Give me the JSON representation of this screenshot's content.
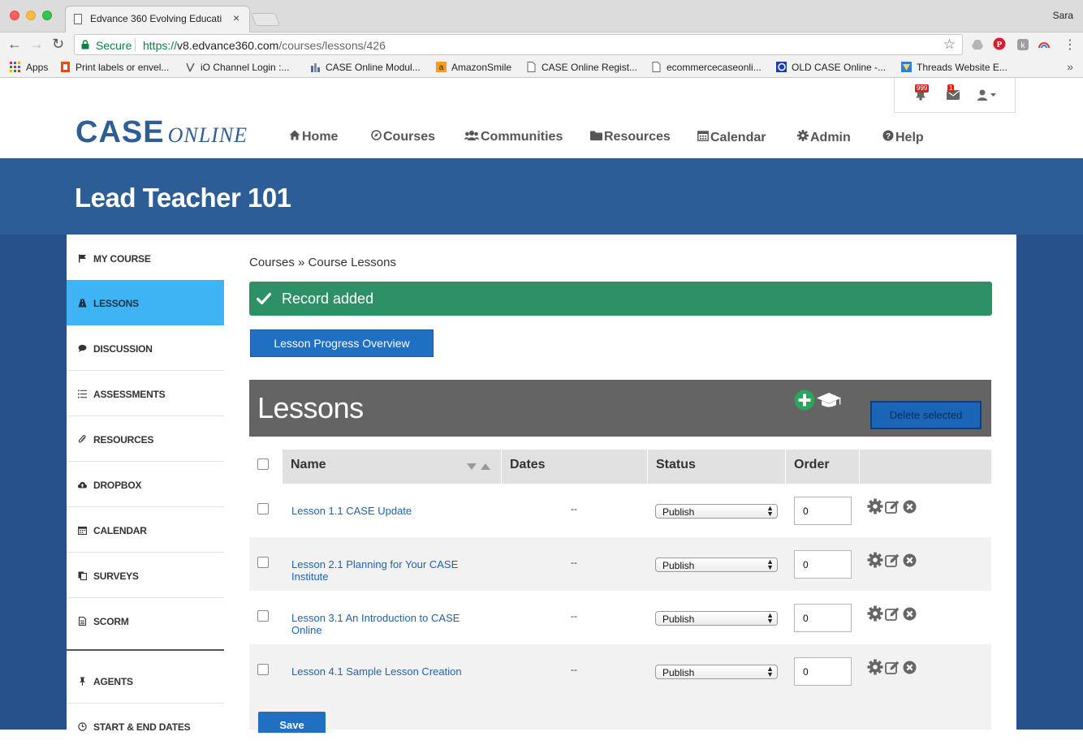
{
  "browser": {
    "tab_title": "Edvance 360 Evolving Educati",
    "tab_close": "×",
    "user_name": "Sara",
    "secure_label": "Secure",
    "url_scheme": "https://",
    "url_host": "v8.edvance360.com",
    "url_path": "/courses/lessons/426"
  },
  "bookmarks": [
    {
      "label": "Apps"
    },
    {
      "label": "Print labels or envel..."
    },
    {
      "label": "iO Channel Login :..."
    },
    {
      "label": "CASE Online Modul..."
    },
    {
      "label": "AmazonSmile"
    },
    {
      "label": "CASE Online Regist..."
    },
    {
      "label": "ecommercecaseonli..."
    },
    {
      "label": "OLD CASE Online -..."
    },
    {
      "label": "Threads Website E..."
    }
  ],
  "header": {
    "notification_count": "999",
    "message_count": "1",
    "logo_case": "CASE",
    "logo_online": "ONLINE",
    "nav": [
      {
        "label": "Home",
        "icon": "home-icon"
      },
      {
        "label": "Courses",
        "icon": "compass-icon"
      },
      {
        "label": "Communities",
        "icon": "users-icon"
      },
      {
        "label": "Resources",
        "icon": "folder-icon"
      },
      {
        "label": "Calendar",
        "icon": "calendar-icon"
      },
      {
        "label": "Admin",
        "icon": "gear-icon"
      },
      {
        "label": "Help",
        "icon": "question-icon"
      }
    ]
  },
  "banner": {
    "title": "Lead Teacher 101"
  },
  "sidebar": {
    "items": [
      {
        "label": "MY COURSE",
        "icon": "flag-icon",
        "active": false
      },
      {
        "label": "LESSONS",
        "icon": "road-icon",
        "active": true
      },
      {
        "label": "DISCUSSION",
        "icon": "comments-icon",
        "active": false
      },
      {
        "label": "ASSESSMENTS",
        "icon": "list-icon",
        "active": false
      },
      {
        "label": "RESOURCES",
        "icon": "paperclip-icon",
        "active": false
      },
      {
        "label": "DROPBOX",
        "icon": "cloud-upload-icon",
        "active": false
      },
      {
        "label": "CALENDAR",
        "icon": "calendar-icon",
        "active": false
      },
      {
        "label": "SURVEYS",
        "icon": "copy-icon",
        "active": false
      },
      {
        "label": "SCORM",
        "icon": "file-icon",
        "active": false
      },
      {
        "label": "AGENTS",
        "icon": "pin-icon",
        "active": false
      },
      {
        "label": "START & END DATES",
        "icon": "clock-icon",
        "active": false
      }
    ]
  },
  "main": {
    "breadcrumb_root": "Courses",
    "breadcrumb_sep": "»",
    "breadcrumb_current": "Course Lessons",
    "alert_text": "Record added",
    "progress_button": "Lesson Progress Overview",
    "section_title": "Lessons",
    "delete_button": "Delete selected",
    "save_button": "Save",
    "columns": [
      "Name",
      "Dates",
      "Status",
      "Order"
    ],
    "lessons": [
      {
        "name": "Lesson 1.1 CASE Update",
        "dates": "--",
        "status": "Publish",
        "order": "0"
      },
      {
        "name": "Lesson 2.1 Planning for Your CASE Institute",
        "dates": "--",
        "status": "Publish",
        "order": "0"
      },
      {
        "name": "Lesson 3.1 An Introduction to CASE Online",
        "dates": "--",
        "status": "Publish",
        "order": "0"
      },
      {
        "name": "Lesson 4.1 Sample Lesson Creation",
        "dates": "--",
        "status": "Publish",
        "order": "0"
      }
    ]
  },
  "colors": {
    "banner": "#2c5d97",
    "page_bg": "#26518a",
    "sidebar_active": "#3fb4f5",
    "alert_green": "#2e9166",
    "primary_button": "#1f6fc2",
    "lessons_header": "#646464",
    "link": "#1d63b3"
  }
}
